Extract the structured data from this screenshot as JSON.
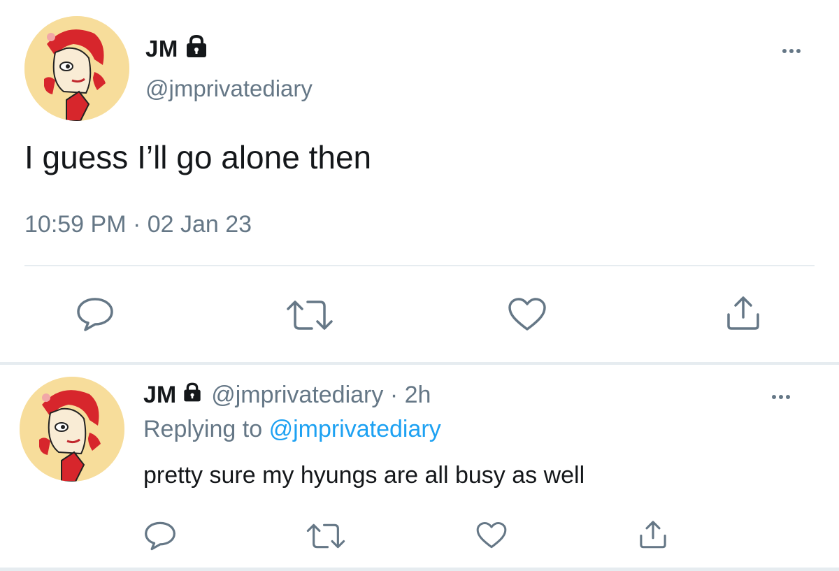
{
  "main_tweet": {
    "display_name": "JM",
    "handle": "@jmprivatediary",
    "text": "I guess I’ll go alone then",
    "timestamp": "10:59 PM · 02 Jan 23",
    "icons": {
      "lock": "lock-icon",
      "more": "more-options-icon",
      "reply": "reply-icon",
      "retweet": "retweet-icon",
      "like": "heart-icon",
      "share": "share-icon"
    }
  },
  "reply_tweet": {
    "display_name": "JM",
    "handle_time": "@jmprivatediary · 2h",
    "replying_prefix": "Replying to",
    "replying_to": "@jmprivatediary",
    "text": "pretty sure my hyungs are all busy as well"
  },
  "colors": {
    "text": "#14171a",
    "secondary": "#657786",
    "accent": "#1da1f2",
    "divider": "#e6ecf0",
    "avatar_bg": "#f7dd9b"
  }
}
